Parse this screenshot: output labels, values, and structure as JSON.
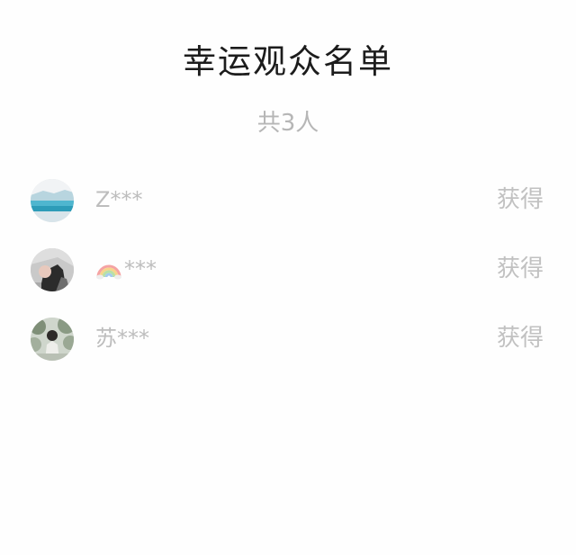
{
  "header": {
    "title": "幸运观众名单",
    "count_label": "共3人"
  },
  "winners": [
    {
      "name": "Z***",
      "status": "获得",
      "avatar": "landscape-avatar"
    },
    {
      "name": "***",
      "name_prefix_icon": "rainbow-icon",
      "status": "获得",
      "avatar": "person-avatar"
    },
    {
      "name": "苏***",
      "status": "获得",
      "avatar": "outdoor-avatar"
    }
  ],
  "colors": {
    "title": "#1c1c1c",
    "secondary_text": "#bdbdbd",
    "background": "#ffffff"
  }
}
